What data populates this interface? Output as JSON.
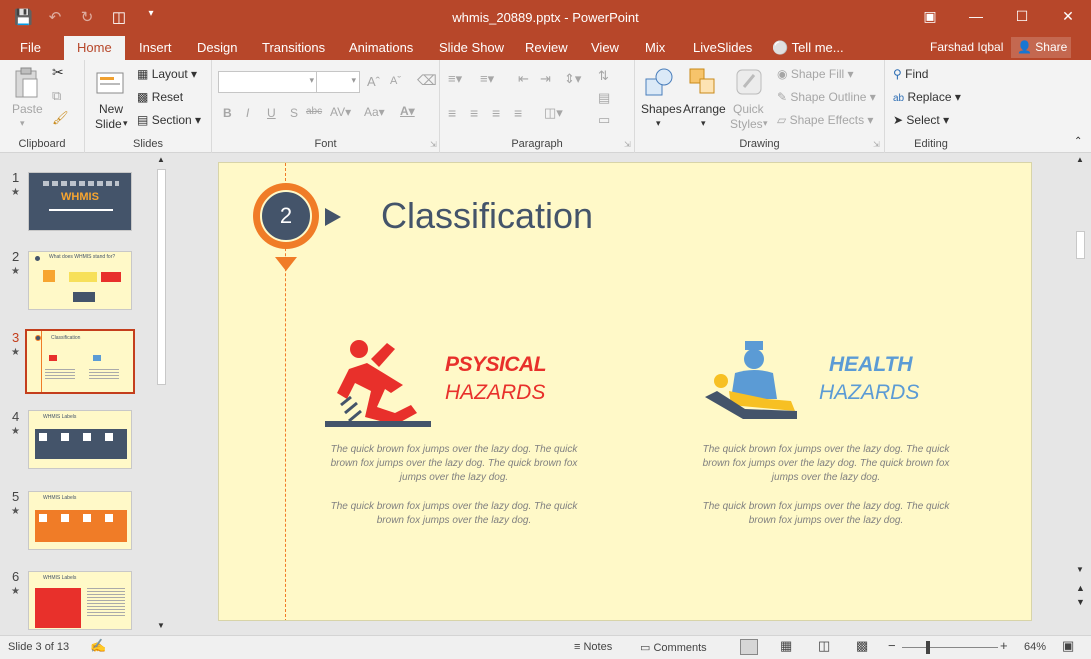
{
  "titlebar": {
    "title": "whmis_20889.pptx - PowerPoint"
  },
  "tabs": [
    "File",
    "Home",
    "Insert",
    "Design",
    "Transitions",
    "Animations",
    "Slide Show",
    "Review",
    "View",
    "Mix",
    "LiveSlides"
  ],
  "tell_me": "Tell me...",
  "account": {
    "name": "Farshad Iqbal",
    "share": "Share"
  },
  "ribbon": {
    "clipboard": {
      "label": "Clipboard",
      "paste": "Paste"
    },
    "slides": {
      "label": "Slides",
      "new_slide_1": "New",
      "new_slide_2": "Slide",
      "layout": "Layout",
      "reset": "Reset",
      "section": "Section"
    },
    "font": {
      "label": "Font",
      "bold": "B",
      "italic": "I",
      "underline": "U",
      "shadow": "S",
      "strike": "abc"
    },
    "paragraph": {
      "label": "Paragraph"
    },
    "drawing": {
      "label": "Drawing",
      "shapes": "Shapes",
      "arrange": "Arrange",
      "quick_1": "Quick",
      "quick_2": "Styles",
      "fill": "Shape Fill",
      "outline": "Shape Outline",
      "effects": "Shape Effects"
    },
    "editing": {
      "label": "Editing",
      "find": "Find",
      "replace": "Replace",
      "select": "Select"
    }
  },
  "thumbnails": [
    {
      "num": "1",
      "title": "WHMIS"
    },
    {
      "num": "2",
      "title": "What does WHMIS stand for?"
    },
    {
      "num": "3",
      "title": "Classification"
    },
    {
      "num": "4",
      "title": "WHMIS Labels"
    },
    {
      "num": "5",
      "title": "WHMIS Labels"
    },
    {
      "num": "6",
      "title": "WHMIS Labels"
    }
  ],
  "slide": {
    "number": "2",
    "title": "Classification",
    "left": {
      "line1": "PSYSICAL",
      "line2": "HAZARDS"
    },
    "right": {
      "line1": "HEALTH",
      "line2": "HAZARDS"
    },
    "body_text": "The quick brown fox jumps over the lazy dog. The quick brown fox jumps over the lazy dog. The quick brown fox jumps over the lazy dog.",
    "body_text2": "The quick brown fox jumps over the lazy dog. The quick brown fox jumps over the lazy dog.",
    "colors": {
      "accent_orange": "#f07c27",
      "accent_red": "#e8302b",
      "accent_blue": "#5b9bd5",
      "dark": "#44546a"
    }
  },
  "status": {
    "slide_info": "Slide 3 of 13",
    "notes": "Notes",
    "comments": "Comments",
    "zoom": "64%"
  }
}
